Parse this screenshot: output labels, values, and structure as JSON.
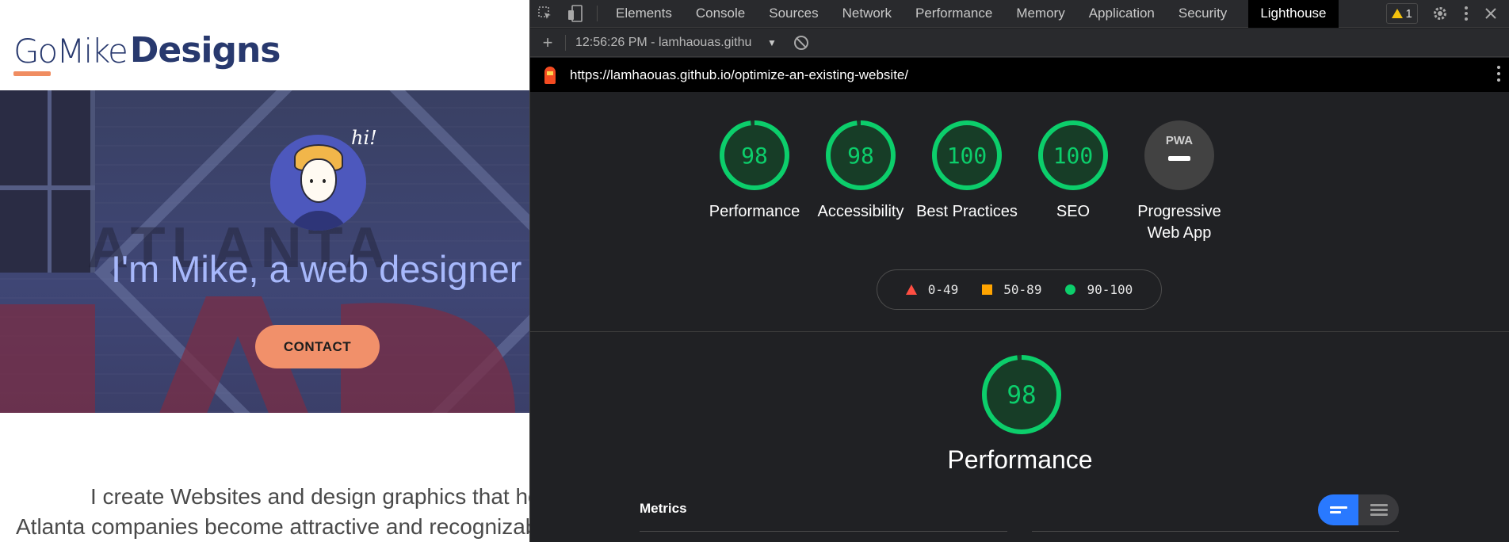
{
  "website": {
    "logo_light": "GoMike",
    "logo_bold": "Designs",
    "hi_text": "hi!",
    "hero_title": "I'm Mike, a web designer",
    "contact_label": "CONTACT",
    "intro_line1": "I create Websites and design graphics that he",
    "intro_line2": "Atlanta companies become attractive and recognizab"
  },
  "devtools": {
    "tabs": [
      "Elements",
      "Console",
      "Sources",
      "Network",
      "Performance",
      "Memory",
      "Application",
      "Security",
      "Lighthouse"
    ],
    "active_tab": "Lighthouse",
    "warning_count": "1",
    "report_selector": "12:56:26 PM - lamhaouas.githu",
    "url": "https://lamhaouas.github.io/optimize-an-existing-website/",
    "categories": [
      {
        "label": "Performance",
        "score": "98",
        "value": 98
      },
      {
        "label": "Accessibility",
        "score": "98",
        "value": 98
      },
      {
        "label": "Best Practices",
        "score": "100",
        "value": 100
      },
      {
        "label": "SEO",
        "score": "100",
        "value": 100
      },
      {
        "label": "Progressive Web App",
        "badge": "PWA"
      }
    ],
    "legend": {
      "fail": "0-49",
      "average": "50-89",
      "pass": "90-100"
    },
    "section": {
      "score": "98",
      "value": 98,
      "title": "Performance",
      "metrics_label": "Metrics"
    },
    "colors": {
      "pass": "#0cce6b",
      "average": "#ffa400",
      "fail": "#ff4e42",
      "active_toggle": "#2979ff"
    }
  }
}
